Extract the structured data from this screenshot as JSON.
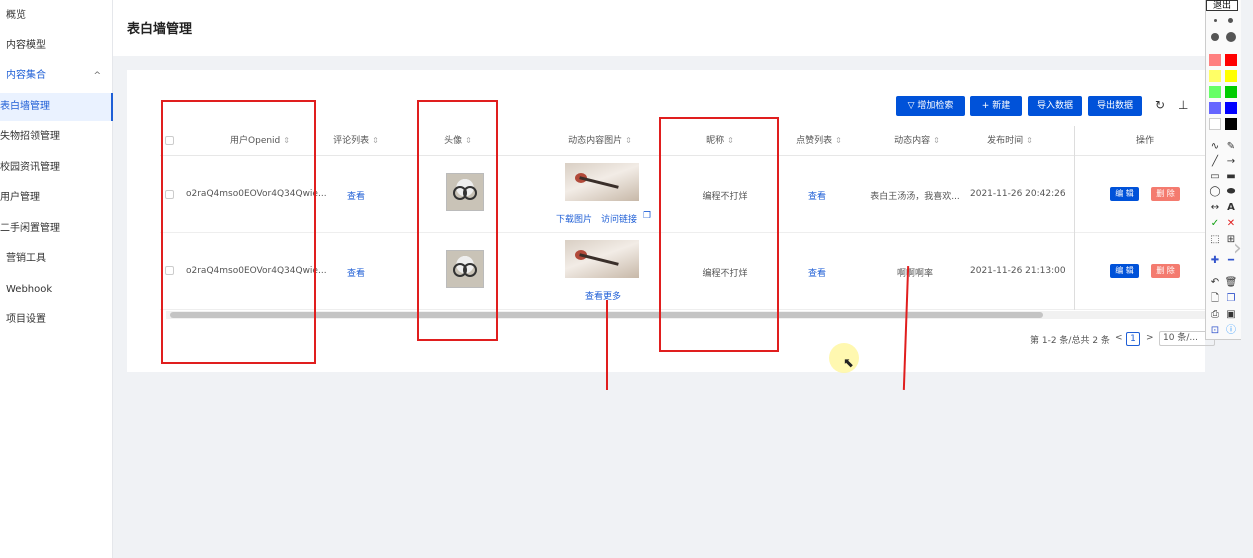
{
  "sidebar": {
    "items": [
      {
        "label": "概览"
      },
      {
        "label": "内容模型"
      },
      {
        "label": "内容集合",
        "chevron": "^"
      },
      {
        "label": "表白墙管理"
      },
      {
        "label": "失物招领管理"
      },
      {
        "label": "校园资讯管理"
      },
      {
        "label": "用户管理"
      },
      {
        "label": "二手闲置管理"
      },
      {
        "label": "营销工具"
      },
      {
        "label": "Webhook"
      },
      {
        "label": "项目设置"
      }
    ]
  },
  "header": {
    "title": "表白墙管理"
  },
  "toolbar": {
    "search_btn": "增加检索",
    "new_btn": "新建",
    "import_btn": "导入数据",
    "export_btn": "导出数据",
    "filter_icon": "funnel-icon",
    "plus_icon": "plus-icon",
    "refresh_icon": "refresh-icon",
    "density_icon": "density-icon"
  },
  "table": {
    "columns": [
      "用户Openid",
      "评论列表",
      "头像",
      "动态内容图片",
      "昵称",
      "点赞列表",
      "动态内容",
      "发布时间",
      "操作"
    ],
    "rows": [
      {
        "openid": "o2raQ4mso0EOVor4Q34Qwie...",
        "comments": "查看",
        "image_links": {
          "download": "下载图片",
          "visit": "访问链接"
        },
        "nickname": "编程不打烊",
        "likes": "查看",
        "content": "表白王汤汤，我喜欢...",
        "time": "2021-11-26 20:42:26",
        "edit": "编 辑",
        "delete": "删 除"
      },
      {
        "openid": "o2raQ4mso0EOVor4Q34Qwie...",
        "comments": "查看",
        "image_links": {
          "more": "查看更多"
        },
        "nickname": "编程不打烊",
        "likes": "查看",
        "content": "啊啊啊率",
        "time": "2021-11-26 21:13:00",
        "edit": "编 辑",
        "delete": "删 除"
      }
    ]
  },
  "pagination": {
    "summary": "第 1-2 条/总共 2 条",
    "current": "1",
    "prev": "<",
    "next": ">",
    "page_size": "10 条/..."
  },
  "palette": {
    "quit": "退出",
    "text_tool": "A",
    "colors": [
      "#ff8080",
      "#ff0000",
      "#ffff66",
      "#ffff00",
      "#66ff66",
      "#00cc00",
      "#6666ff",
      "#0000ff",
      "#ffffff",
      "#000000"
    ]
  },
  "colors": {
    "accent": "#0052d9",
    "danger": "#f47b6f",
    "annotation": "#e01e1e"
  }
}
